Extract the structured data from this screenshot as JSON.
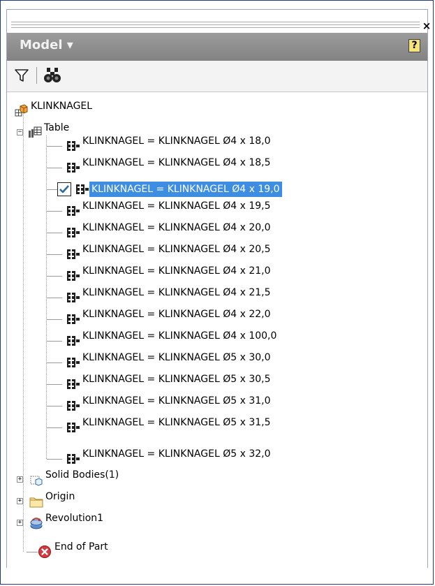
{
  "panel": {
    "close_glyph": "×",
    "title": "Model ▾",
    "help_glyph": "?"
  },
  "toolbar": {
    "filter_icon": "filter-icon",
    "find_icon": "binoculars-icon"
  },
  "tree": {
    "root": "KLINKNAGEL",
    "table": "Table",
    "rows": [
      "KLINKNAGEL = KLINKNAGEL Ø4 x 18,0",
      "KLINKNAGEL = KLINKNAGEL Ø4 x 18,5",
      "KLINKNAGEL = KLINKNAGEL Ø4 x 19,0",
      "KLINKNAGEL = KLINKNAGEL Ø4 x 19,5",
      "KLINKNAGEL = KLINKNAGEL Ø4 x 20,0",
      "KLINKNAGEL = KLINKNAGEL Ø4 x 20,5",
      "KLINKNAGEL = KLINKNAGEL Ø4 x 21,0",
      "KLINKNAGEL = KLINKNAGEL Ø4 x 21,5",
      "KLINKNAGEL = KLINKNAGEL Ø4 x 22,0",
      "KLINKNAGEL = KLINKNAGEL Ø4 x 100,0",
      "KLINKNAGEL = KLINKNAGEL Ø5 x 30,0",
      "KLINKNAGEL = KLINKNAGEL Ø5 x 30,5",
      "KLINKNAGEL = KLINKNAGEL Ø5 x 31,0",
      "KLINKNAGEL = KLINKNAGEL Ø5 x 31,5",
      "KLINKNAGEL = KLINKNAGEL Ø5 x 32,0"
    ],
    "active_row": 2,
    "solid_bodies": "Solid Bodies(1)",
    "origin": "Origin",
    "revolution": "Revolution1",
    "end_of_part": "End of Part"
  },
  "colors": {
    "highlight": "#3d8ee3",
    "header": "#8f8f8f"
  }
}
